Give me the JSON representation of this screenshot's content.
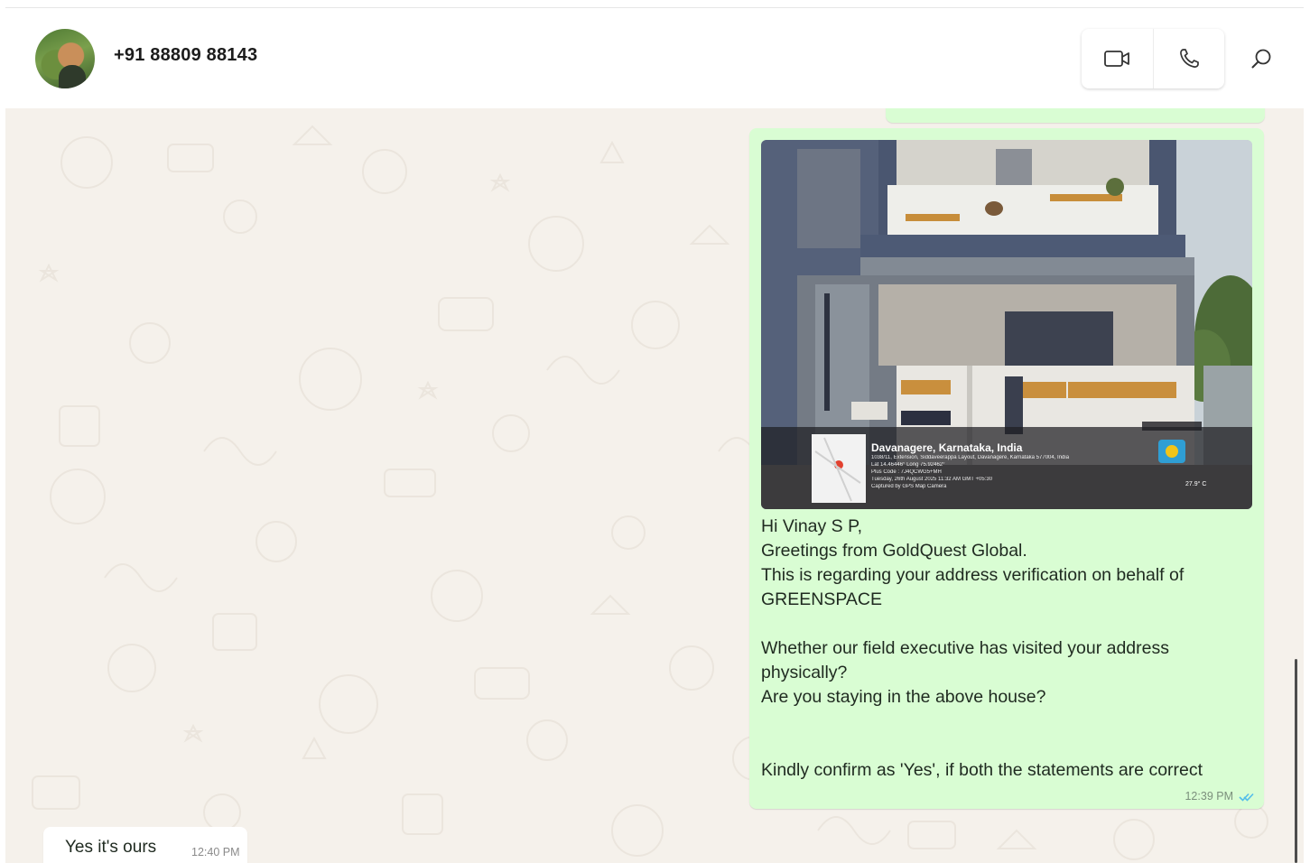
{
  "header": {
    "contact_name": "+91 88809 88143",
    "icons": {
      "video": "video-camera-icon",
      "voice": "phone-icon",
      "search": "search-icon"
    }
  },
  "messages": [
    {
      "direction": "outgoing",
      "photo": {
        "place": "Davanagere, Karnataka, India",
        "meta_lines": [
          "1038/11, Extension, Siddaveerappa Layout, Davanagere, Karnataka 577004, India",
          "Lat 14.46446° Long 75.92462°",
          "Plus Code : 7J4QCWG5+MH",
          "Tuesday, 26th August 2025 11:32 AM GMT +05:30",
          "Captured by GPS Map Camera"
        ],
        "temperature": "27.9° C"
      },
      "text": "Hi Vinay S P,\nGreetings from GoldQuest Global.\nThis is regarding your address verification on behalf of GREENSPACE\n\nWhether our field executive has visited your address physically?\nAre you staying in the above house?\n\n\nKindly confirm as 'Yes', if both the statements are correct",
      "time": "12:39 PM",
      "status_icon": "double-check-icon"
    },
    {
      "direction": "incoming",
      "text": "Yes it's ours",
      "time": "12:40 PM"
    }
  ],
  "colors": {
    "outgoing_bubble": "#d9fdd3",
    "incoming_bubble": "#ffffff",
    "chat_background": "#f5f1eb",
    "read_ticks": "#53bdeb"
  }
}
